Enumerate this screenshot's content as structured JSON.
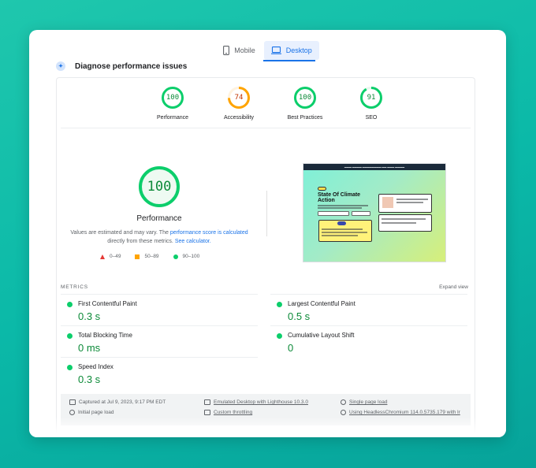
{
  "tabs": [
    {
      "label": "Mobile",
      "icon": "mobile-phone-icon",
      "active": false
    },
    {
      "label": "Desktop",
      "icon": "desktop-monitor-icon",
      "active": true
    }
  ],
  "section_title": "Diagnose performance issues",
  "gauges": [
    {
      "value": "100",
      "label": "Performance",
      "score": 100,
      "color": "#0cce6b",
      "text_color": "#0c8a38"
    },
    {
      "value": "74",
      "label": "Accessibility",
      "score": 74,
      "color": "#ffa400",
      "text_color": "#c33300"
    },
    {
      "value": "100",
      "label": "Best Practices",
      "score": 100,
      "color": "#0cce6b",
      "text_color": "#0c8a38"
    },
    {
      "value": "91",
      "label": "SEO",
      "score": 91,
      "color": "#0cce6b",
      "text_color": "#0c8a38"
    }
  ],
  "main_score": {
    "value": "100",
    "label": "Performance",
    "score": 100
  },
  "note": {
    "prefix": "Values are estimated and may vary. The ",
    "link1": "performance score is calculated",
    "middle": " directly from these metrics. ",
    "link2": "See calculator."
  },
  "legend": [
    {
      "label": "0–49",
      "shape": "triangle",
      "color": "#e53935"
    },
    {
      "label": "50–89",
      "shape": "square",
      "color": "#ffa400"
    },
    {
      "label": "90–100",
      "shape": "circle",
      "color": "#0cce6b"
    }
  ],
  "screenshot": {
    "title": "State Of Climate Action"
  },
  "metrics_title": "METRICS",
  "expand_label": "Expand view",
  "metrics": [
    {
      "name": "First Contentful Paint",
      "value": "0.3 s"
    },
    {
      "name": "Largest Contentful Paint",
      "value": "0.5 s"
    },
    {
      "name": "Total Blocking Time",
      "value": "0 ms"
    },
    {
      "name": "Cumulative Layout Shift",
      "value": "0"
    },
    {
      "name": "Speed Index",
      "value": "0.3 s"
    }
  ],
  "footer": [
    {
      "text": "Captured at Jul 9, 2023, 9:17 PM EDT",
      "icon": "calendar-icon",
      "link": false
    },
    {
      "text": "Emulated Desktop with Lighthouse 10.3.0",
      "icon": "laptop-icon",
      "link": true
    },
    {
      "text": "Single page load",
      "icon": "users-icon",
      "link": true
    },
    {
      "text": "Initial page load",
      "icon": "timer-icon",
      "link": false
    },
    {
      "text": "Custom throttling",
      "icon": "wifi-icon",
      "link": true
    },
    {
      "text": "Using HeadlessChromium 114.0.5735.179 with lr",
      "icon": "chromium-icon",
      "link": true
    }
  ]
}
